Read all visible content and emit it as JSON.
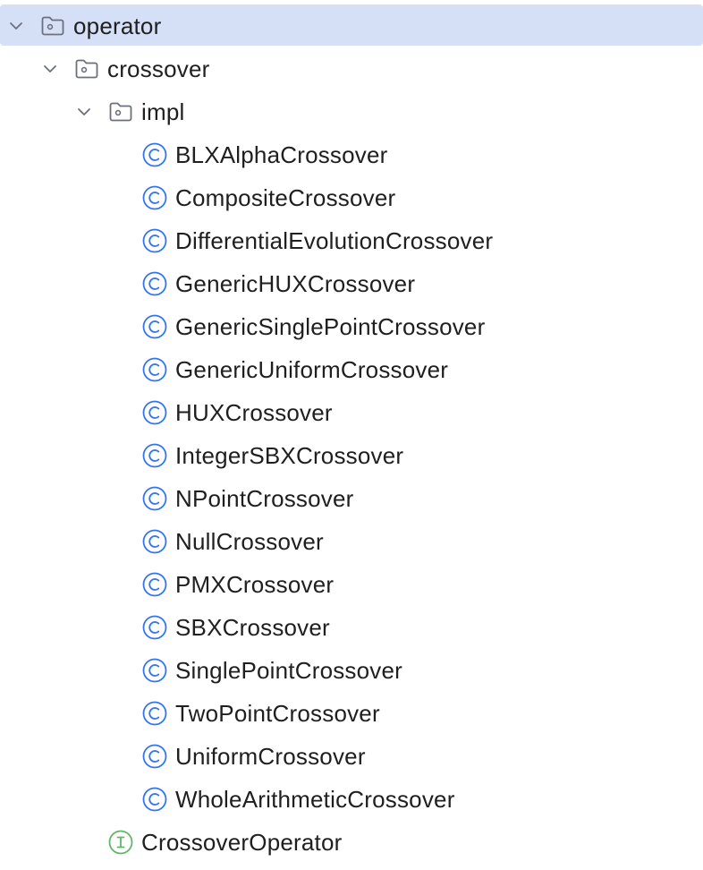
{
  "tree": {
    "root": {
      "label": "operator",
      "icon": "folder-icon",
      "expanded": true,
      "selected": true
    },
    "crossover": {
      "label": "crossover",
      "icon": "folder-icon",
      "expanded": true
    },
    "impl": {
      "label": "impl",
      "icon": "folder-icon",
      "expanded": true
    },
    "classes": [
      {
        "label": "BLXAlphaCrossover",
        "icon": "class-icon"
      },
      {
        "label": "CompositeCrossover",
        "icon": "class-icon"
      },
      {
        "label": "DifferentialEvolutionCrossover",
        "icon": "class-icon"
      },
      {
        "label": "GenericHUXCrossover",
        "icon": "class-icon"
      },
      {
        "label": "GenericSinglePointCrossover",
        "icon": "class-icon"
      },
      {
        "label": "GenericUniformCrossover",
        "icon": "class-icon"
      },
      {
        "label": "HUXCrossover",
        "icon": "class-icon"
      },
      {
        "label": "IntegerSBXCrossover",
        "icon": "class-icon"
      },
      {
        "label": "NPointCrossover",
        "icon": "class-icon"
      },
      {
        "label": "NullCrossover",
        "icon": "class-icon"
      },
      {
        "label": "PMXCrossover",
        "icon": "class-icon"
      },
      {
        "label": "SBXCrossover",
        "icon": "class-icon"
      },
      {
        "label": "SinglePointCrossover",
        "icon": "class-icon"
      },
      {
        "label": "TwoPointCrossover",
        "icon": "class-icon"
      },
      {
        "label": "UniformCrossover",
        "icon": "class-icon"
      },
      {
        "label": "WholeArithmeticCrossover",
        "icon": "class-icon"
      }
    ],
    "interface": {
      "label": "CrossoverOperator",
      "icon": "interface-icon"
    }
  },
  "colors": {
    "selection": "#d5e0f7",
    "folder_stroke": "#6c707e",
    "class_icon": "#3574f0",
    "interface_icon": "#5fb865",
    "chevron": "#6c707e",
    "text": "#1f1f1f"
  }
}
